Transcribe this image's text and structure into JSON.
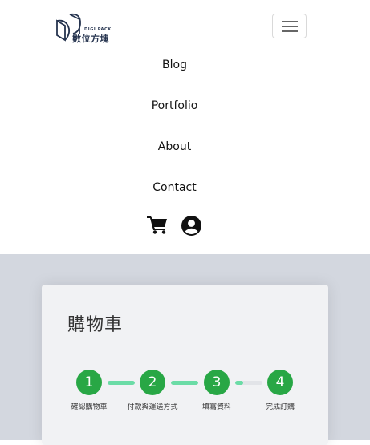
{
  "logo": {
    "small_text": "DIGI PACK",
    "name": "數位方塊"
  },
  "nav": {
    "items": [
      "Blog",
      "Portfolio",
      "About",
      "Contact"
    ]
  },
  "icons": {
    "cart": "shopping-cart-icon",
    "user": "user-circle-icon",
    "menu": "hamburger-menu-icon"
  },
  "cart": {
    "title": "購物車",
    "steps": [
      {
        "number": "1",
        "label": "確認購物車"
      },
      {
        "number": "2",
        "label": "付款與運送方式"
      },
      {
        "number": "3",
        "label": "填寫資料"
      },
      {
        "number": "4",
        "label": "完成訂購"
      }
    ],
    "progress": [
      1.0,
      1.0,
      0.3
    ]
  },
  "colors": {
    "step": "#28a745",
    "progress_fill": "#6bdca6",
    "progress_track": "#e2e4e8",
    "page_bg": "#d3d7df"
  }
}
